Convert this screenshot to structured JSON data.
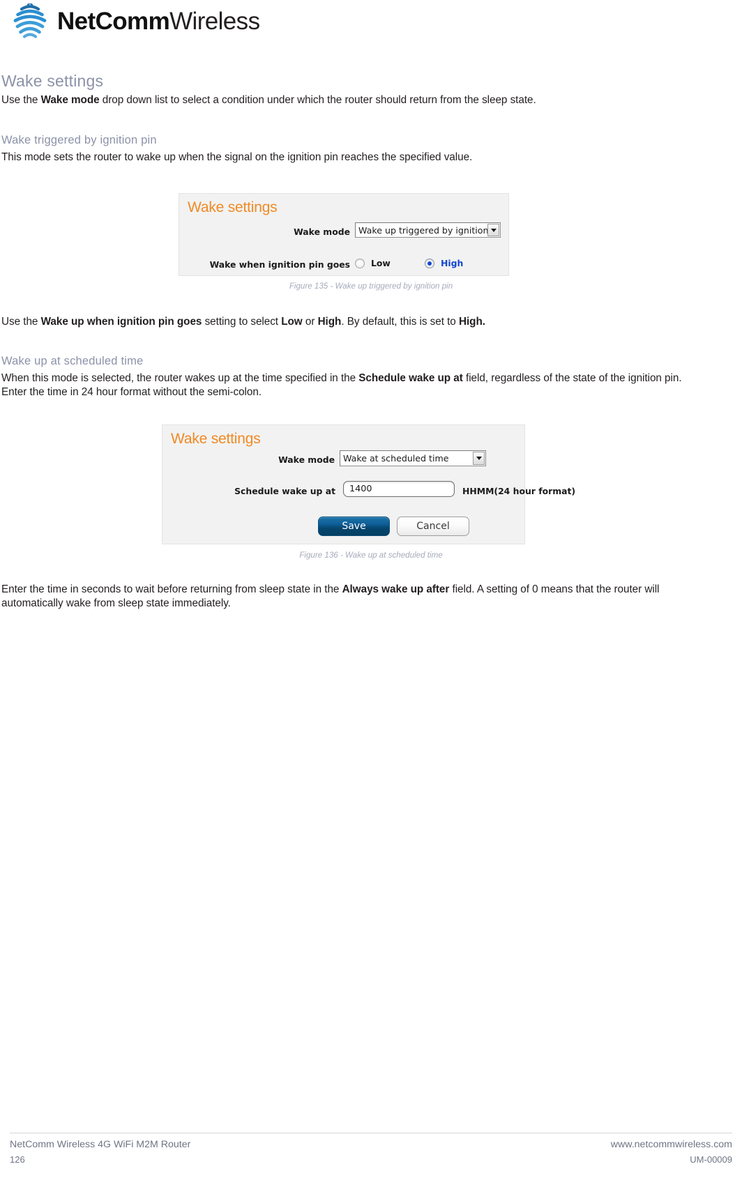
{
  "brand": {
    "logo_icon": "wifi-signal-arcs-icon",
    "name_bold": "NetComm",
    "name_light": "Wireless",
    "accent_blue": "#2b8fd0"
  },
  "sections": [
    {
      "heading": "Wake settings",
      "body": "Use the Wake mode drop down list to select a condition under which the router should return from the sleep state."
    }
  ],
  "section1": {
    "heading": "Wake settings",
    "body_pre": "Use the ",
    "body_bold": "Wake mode",
    "body_post": " drop down list to select a condition under which the router should return from the sleep state."
  },
  "section2": {
    "heading": "Wake triggered by ignition pin",
    "body": "This mode sets the router to wake up when the signal on the ignition pin reaches the specified value."
  },
  "figure1": {
    "title": "Wake settings",
    "wake_mode_label": "Wake mode",
    "wake_mode_value": "Wake up triggered by ignition pin",
    "pin_label": "Wake when ignition pin goes",
    "radio_low": "Low",
    "radio_high": "High",
    "selected": "High",
    "caption": "Figure 135 - Wake up triggered by ignition pin",
    "title_color": "#f08a24"
  },
  "paragraph_after_fig1": {
    "pre": "Use the ",
    "b1": "Wake up when ignition pin goes",
    "mid1": " setting to select ",
    "b2": "Low",
    "mid2": " or ",
    "b3": "High",
    "mid3": ". By default, this is set to ",
    "b4": "High."
  },
  "section3": {
    "heading": "Wake up at scheduled time",
    "body_pre": "When this mode is selected, the router wakes up at the time specified in the ",
    "body_bold": "Schedule wake up at",
    "body_post": " field, regardless of the state of the ignition pin. Enter the time in 24 hour format without the semi-colon."
  },
  "figure2": {
    "title": "Wake settings",
    "wake_mode_label": "Wake mode",
    "wake_mode_value": "Wake at scheduled time",
    "schedule_label": "Schedule wake up at",
    "schedule_value": "1400",
    "schedule_placeholder": "HHMM",
    "format_hint": "HHMM(24 hour format)",
    "save_label": "Save",
    "cancel_label": "Cancel",
    "caption": "Figure 136 - Wake up at scheduled time",
    "title_color": "#f08a24"
  },
  "paragraph_after_fig2": {
    "pre": "Enter the time in seconds to wait before returning from sleep state in the ",
    "b1": "Always wake up after",
    "post": " field. A setting of 0 means that the router will automatically wake from sleep state immediately."
  },
  "footer": {
    "product": "NetComm Wireless 4G WiFi M2M Router",
    "page_number": "126",
    "website": "www.netcommwireless.com",
    "doc_id": "UM-00009"
  }
}
